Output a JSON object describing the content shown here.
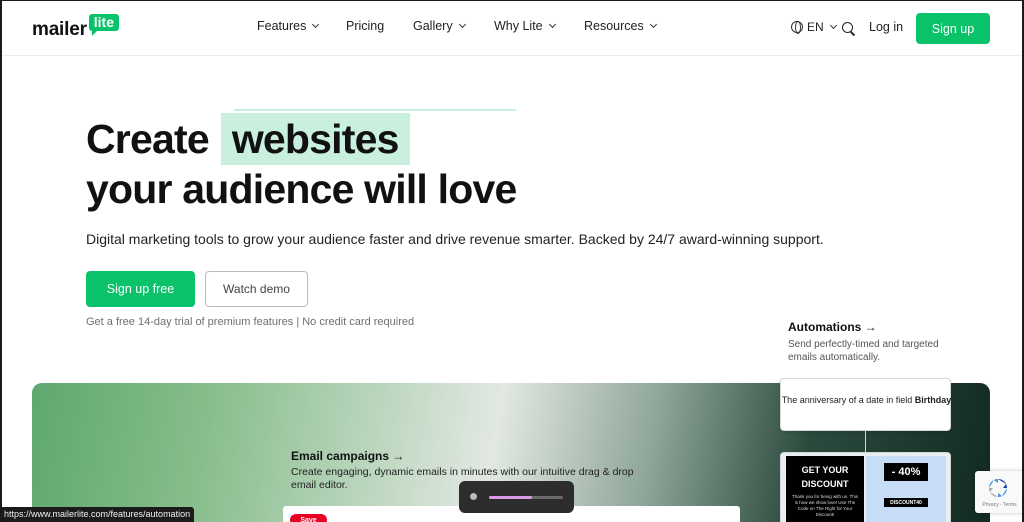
{
  "header": {
    "logo_text": "mailer",
    "logo_badge": "lite",
    "nav": [
      {
        "label": "Features",
        "has_dropdown": true
      },
      {
        "label": "Pricing",
        "has_dropdown": false
      },
      {
        "label": "Gallery",
        "has_dropdown": true
      },
      {
        "label": "Why Lite",
        "has_dropdown": true
      },
      {
        "label": "Resources",
        "has_dropdown": true
      }
    ],
    "language": "EN",
    "login_label": "Log in",
    "signup_label": "Sign up"
  },
  "hero": {
    "line1_prefix": "Create",
    "line1_highlight": "websites",
    "line2": "your audience will love",
    "subtitle": "Digital marketing tools to grow your audience faster and drive revenue smarter. Backed by 24/7 award-winning support.",
    "primary_cta": "Sign up free",
    "secondary_cta": "Watch demo",
    "trial_note": "Get a free 14-day trial of premium features | No credit card required"
  },
  "automations": {
    "title": "Automations →",
    "description": "Send perfectly-timed and targeted emails automatically.",
    "trigger_text": "The anniversary of a date in field",
    "trigger_field": "Birthday"
  },
  "email_campaigns": {
    "title": "Email campaigns →",
    "description": "Create engaging, dynamic emails in minutes with our intuitive drag & drop email editor.",
    "pin_label": "Save"
  },
  "promo": {
    "headline_1": "GET YOUR",
    "headline_2": "DISCOUNT",
    "fine_print": "Thank you for being with us. This is how we show love! Use The Code on The Right for Your Discount!",
    "percent": "- 40%",
    "code": "DISCOUNT40"
  },
  "recaptcha": {
    "links": "Privacy - Terms"
  },
  "video_control": {
    "progress": 0.58
  },
  "status_bar": {
    "url": "https://www.mailerlite.com/features/automation"
  },
  "colors": {
    "brand_green": "#09c269",
    "highlight": "#c9f0de"
  }
}
